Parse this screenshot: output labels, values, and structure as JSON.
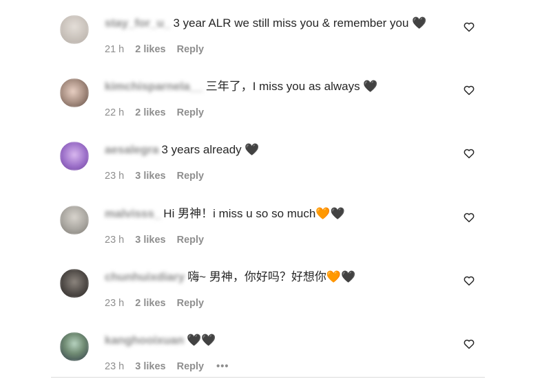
{
  "comments": [
    {
      "username": "stay_for_u_",
      "text": "3 year ALR we still miss you & remember you 🖤",
      "time": "21 h",
      "likes": "2 likes",
      "reply": "Reply",
      "avatar_color": "#c9c2bb"
    },
    {
      "username": "kimchisparnela__",
      "text": "三年了，I miss you as always 🖤",
      "time": "22 h",
      "likes": "2 likes",
      "reply": "Reply",
      "avatar_color": "#a88f82"
    },
    {
      "username": "aesalegra",
      "text": "3 years already 🖤",
      "time": "23 h",
      "likes": "3 likes",
      "reply": "Reply",
      "avatar_color": "#9b6fc8"
    },
    {
      "username": "malvisss_",
      "text": "Hi 男神！i miss u so so much🧡🖤",
      "time": "23 h",
      "likes": "3 likes",
      "reply": "Reply",
      "avatar_color": "#a9a6a0"
    },
    {
      "username": "chunhuixdiary",
      "text": "嗨~ 男神，你好吗？好想你🧡🖤",
      "time": "23 h",
      "likes": "2 likes",
      "reply": "Reply",
      "avatar_color": "#4f4a46"
    },
    {
      "username": "kanghooixuan",
      "text": "🖤🖤",
      "time": "23 h",
      "likes": "3 likes",
      "reply": "Reply",
      "more": "•••",
      "avatar_color": "#6f8a72"
    }
  ],
  "icons": {
    "like": "heart-outline-icon"
  },
  "colors": {
    "text": "#262626",
    "meta": "#8e8e8e",
    "divider": "#dbdbdb"
  }
}
